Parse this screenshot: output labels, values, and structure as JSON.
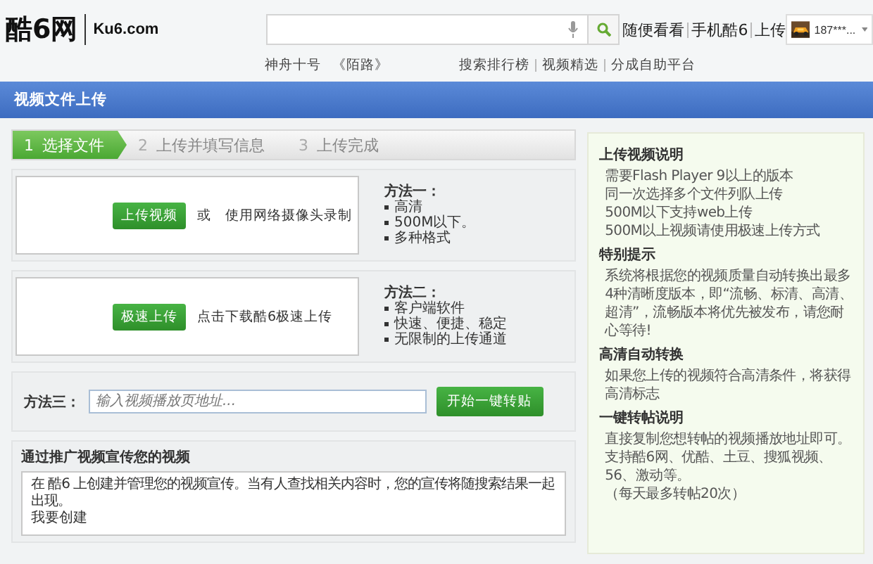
{
  "header": {
    "logo": "酷6网",
    "domain": "Ku6.com",
    "links": [
      "随便看看",
      "手机酷6",
      "上传"
    ],
    "user": {
      "name": "187***..."
    },
    "hot_links": [
      "神舟十号",
      "《陌路》"
    ],
    "nav_links": [
      "搜索排行榜",
      "视频精选",
      "分成自助平台"
    ]
  },
  "page_title": "视频文件上传",
  "steps": [
    {
      "number": "1",
      "label": "选择文件",
      "selected": true
    },
    {
      "number": "2",
      "label": "上传并填写信息",
      "selected": false
    },
    {
      "number": "3",
      "label": "上传完成",
      "selected": false
    }
  ],
  "methods": [
    {
      "kind": "upload",
      "button": "上传视频",
      "text": "或　使用网络摄像头录制",
      "title": "方法一：",
      "features": [
        "高清",
        "500M以下。",
        "多种格式"
      ]
    },
    {
      "kind": "upload",
      "button": "极速上传",
      "text": "点击下载酷6极速上传",
      "title": "方法二：",
      "features": [
        "客户端软件",
        "快速、便捷、稳定",
        "无限制的上传通道"
      ]
    },
    {
      "kind": "link",
      "title": "方法三：",
      "placeholder": "输入视频播放页地址...",
      "button": "开始一键转贴"
    }
  ],
  "promo": {
    "title": "通过推广视频宣传您的视频",
    "text": "在 酷6 上创建并管理您的视频宣传。当有人查找相关内容时，您的宣传将随搜索结果一起出现。",
    "link": "我要创建"
  },
  "sidebar": [
    {
      "title": "上传视频说明",
      "lines": [
        "需要Flash Player 9以上的版本",
        "同一次选择多个文件列队上传",
        "500M以下支持web上传",
        "500M以上视频请使用极速上传方式"
      ]
    },
    {
      "title": "特别提示",
      "lines": [
        "系统将根据您的视频质量自动转换出最多4种清晰度版本，即“流畅、标清、高清、超清”，流畅版本将优先被发布，请您耐心等待!"
      ]
    },
    {
      "title": "高清自动转换",
      "lines": [
        "如果您上传的视频符合高清条件，将获得高清标志"
      ]
    },
    {
      "title": "一键转帖说明",
      "lines": [
        "直接复制您想转帖的视频播放地址即可。",
        "支持酷6网、优酷、土豆、搜狐视频、56、激动等。",
        "（每天最多转帖20次）"
      ]
    }
  ]
}
